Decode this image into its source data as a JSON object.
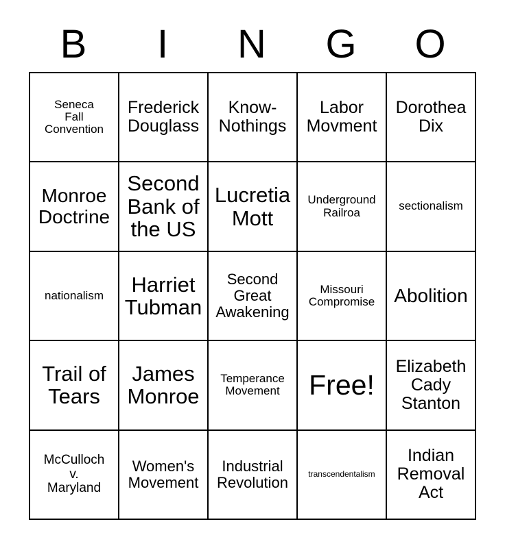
{
  "header": {
    "letters": [
      "B",
      "I",
      "N",
      "G",
      "O"
    ]
  },
  "grid": {
    "rows": [
      [
        {
          "text": "Seneca\nFall\nConvention",
          "size": "fs-m"
        },
        {
          "text": "Frederick\nDouglass",
          "size": "fs-xl"
        },
        {
          "text": "Know-\nNothings",
          "size": "fs-xl"
        },
        {
          "text": "Labor\nMovment",
          "size": "fs-xl"
        },
        {
          "text": "Dorothea\nDix",
          "size": "fs-xl"
        }
      ],
      [
        {
          "text": "Monroe\nDoctrine",
          "size": "fs-xxl"
        },
        {
          "text": "Second\nBank of\nthe US",
          "size": "fs-3xl"
        },
        {
          "text": "Lucretia\nMott",
          "size": "fs-3xl"
        },
        {
          "text": "Underground\nRailroa",
          "size": "fs-m"
        },
        {
          "text": "sectionalism",
          "size": "fs-m"
        }
      ],
      [
        {
          "text": "nationalism",
          "size": "fs-m"
        },
        {
          "text": "Harriet\nTubman",
          "size": "fs-3xl"
        },
        {
          "text": "Second\nGreat\nAwakening",
          "size": "fs-l"
        },
        {
          "text": "Missouri\nCompromise",
          "size": "fs-m"
        },
        {
          "text": "Abolition",
          "size": "fs-xxl"
        }
      ],
      [
        {
          "text": "Trail of\nTears",
          "size": "fs-3xl"
        },
        {
          "text": "James\nMonroe",
          "size": "fs-3xl"
        },
        {
          "text": "Temperance\nMovement",
          "size": "fs-m"
        },
        {
          "text": "Free!",
          "size": "fs-free"
        },
        {
          "text": "Elizabeth\nCady\nStanton",
          "size": "fs-xl"
        }
      ],
      [
        {
          "text": "McCulloch\nv.\nMaryland",
          "size": "fs-ml"
        },
        {
          "text": "Women's\nMovement",
          "size": "fs-l"
        },
        {
          "text": "Industrial\nRevolution",
          "size": "fs-l"
        },
        {
          "text": "transcendentalism",
          "size": "fs-xs"
        },
        {
          "text": "Indian\nRemoval\nAct",
          "size": "fs-xl"
        }
      ]
    ]
  },
  "colors": {
    "background": "#ffffff",
    "text": "#000000",
    "border": "#000000"
  }
}
